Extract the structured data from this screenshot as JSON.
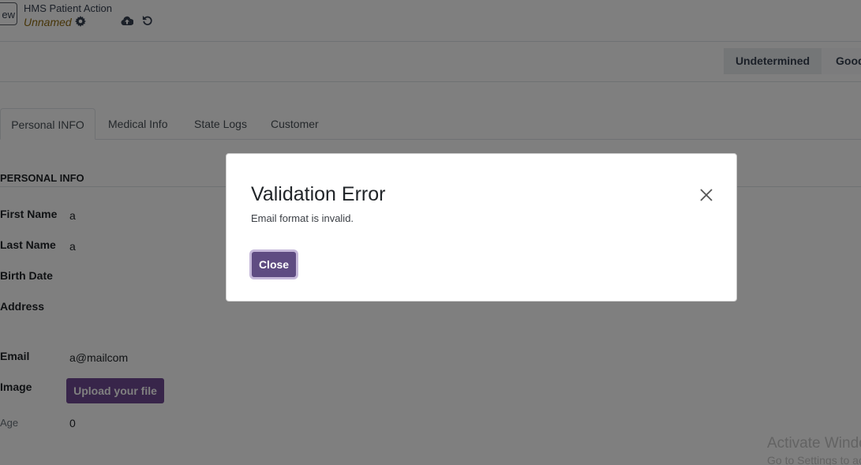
{
  "control_panel": {
    "new_label": "ew",
    "breadcrumb": "HMS Patient Action",
    "record_name": "Unnamed"
  },
  "statusbar": {
    "stages": [
      "Undetermined",
      "Good"
    ]
  },
  "tabs": [
    {
      "label": "Personal INFO",
      "active": true
    },
    {
      "label": "Medical Info",
      "active": false
    },
    {
      "label": "State Logs",
      "active": false
    },
    {
      "label": "Customer",
      "active": false
    }
  ],
  "form": {
    "group_title": "PERSONAL INFO",
    "first_name": {
      "label": "First Name",
      "value": "a"
    },
    "last_name": {
      "label": "Last Name",
      "value": "a"
    },
    "birth_date": {
      "label": "Birth Date",
      "value": ""
    },
    "address": {
      "label": "Address",
      "value": ""
    },
    "email": {
      "label": "Email",
      "value": "a@mailcom"
    },
    "image": {
      "label": "Image",
      "button": "Upload your file"
    },
    "age": {
      "label": "Age",
      "value": "0"
    }
  },
  "watermark": {
    "line1": "Activate Windows",
    "line2": "Go to Settings to activate Windows."
  },
  "dialog": {
    "title": "Validation Error",
    "message": "Email format is invalid.",
    "close_label": "Close"
  },
  "colors": {
    "primary": "#714b94",
    "record_name": "#8f6a10",
    "backdrop": "rgba(0,0,0,0.5)"
  }
}
